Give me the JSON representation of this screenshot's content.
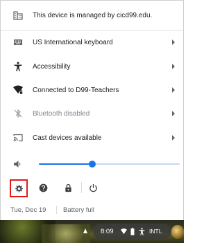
{
  "menu": {
    "managed": "This device is managed by cicd99.edu.",
    "keyboard": "US International keyboard",
    "accessibility": "Accessibility",
    "network": "Connected to D99-Teachers",
    "bluetooth": "Bluetooth disabled",
    "cast": "Cast devices available"
  },
  "volume": {
    "level": 0.38
  },
  "status": {
    "date": "Tue, Dec 19",
    "battery": "Battery full"
  },
  "shelf": {
    "time": "8:09",
    "ime": "INTL"
  },
  "colors": {
    "accent": "#1a73e8",
    "highlight": "#e01a1a",
    "text": "#202124",
    "disabled": "#80868b"
  },
  "icons": {
    "managed": "business-icon",
    "keyboard": "keyboard-icon",
    "accessibility": "accessibility-icon",
    "network": "wifi-lock-icon",
    "bluetooth": "bluetooth-disabled-icon",
    "cast": "cast-icon",
    "volume": "volume-icon",
    "settings": "gear-icon",
    "help": "help-icon",
    "lock": "lock-icon",
    "power": "power-icon"
  }
}
